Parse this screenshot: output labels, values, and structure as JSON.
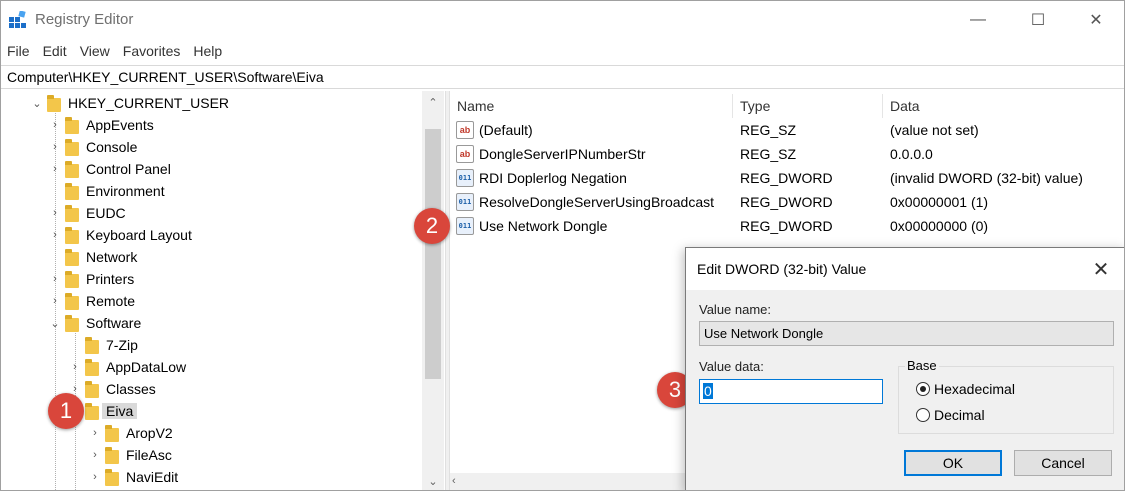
{
  "window": {
    "title": "Registry Editor",
    "controls": {
      "minimize": "—",
      "maximize": "☐",
      "close": "✕"
    }
  },
  "menu": [
    "File",
    "Edit",
    "View",
    "Favorites",
    "Help"
  ],
  "address": "Computer\\HKEY_CURRENT_USER\\Software\\Eiva",
  "tree": {
    "root": "HKEY_CURRENT_USER",
    "items": [
      {
        "label": "AppEvents",
        "expander": "›"
      },
      {
        "label": "Console",
        "expander": "›"
      },
      {
        "label": "Control Panel",
        "expander": "›"
      },
      {
        "label": "Environment",
        "expander": ""
      },
      {
        "label": "EUDC",
        "expander": "›"
      },
      {
        "label": "Keyboard Layout",
        "expander": "›"
      },
      {
        "label": "Network",
        "expander": ""
      },
      {
        "label": "Printers",
        "expander": "›"
      },
      {
        "label": "Remote",
        "expander": "›"
      },
      {
        "label": "Software",
        "expander": "⌄"
      },
      {
        "label": "7-Zip",
        "expander": ""
      },
      {
        "label": "AppDataLow",
        "expander": "›"
      },
      {
        "label": "Classes",
        "expander": "›"
      },
      {
        "label": "Eiva",
        "expander": "⌄",
        "selected": true
      },
      {
        "label": "AropV2",
        "expander": "›"
      },
      {
        "label": "FileAsc",
        "expander": "›"
      },
      {
        "label": "NaviEdit",
        "expander": "›"
      }
    ]
  },
  "list": {
    "columns": {
      "name": "Name",
      "type": "Type",
      "data": "Data"
    },
    "rows": [
      {
        "icon": "ab",
        "name": "(Default)",
        "type": "REG_SZ",
        "data": "(value not set)"
      },
      {
        "icon": "ab",
        "name": "DongleServerIPNumberStr",
        "type": "REG_SZ",
        "data": "0.0.0.0"
      },
      {
        "icon": "011",
        "name": "RDI Doplerlog Negation",
        "type": "REG_DWORD",
        "data": "(invalid DWORD (32-bit) value)"
      },
      {
        "icon": "011",
        "name": "ResolveDongleServerUsingBroadcast",
        "type": "REG_DWORD",
        "data": "0x00000001 (1)"
      },
      {
        "icon": "011",
        "name": "Use Network Dongle",
        "type": "REG_DWORD",
        "data": "0x00000000 (0)"
      }
    ]
  },
  "callouts": [
    "1",
    "2",
    "3"
  ],
  "dialog": {
    "title": "Edit DWORD (32-bit) Value",
    "value_name_label": "Value name:",
    "value_name": "Use Network Dongle",
    "value_data_label": "Value data:",
    "value_data": "0",
    "base_label": "Base",
    "hex_label": "Hexadecimal",
    "dec_label": "Decimal",
    "selected_base": "Hexadecimal",
    "ok": "OK",
    "cancel": "Cancel"
  },
  "colors": {
    "callout": "#d9463b",
    "folder": "#f3c64a",
    "focus_blue": "#0078d7"
  }
}
